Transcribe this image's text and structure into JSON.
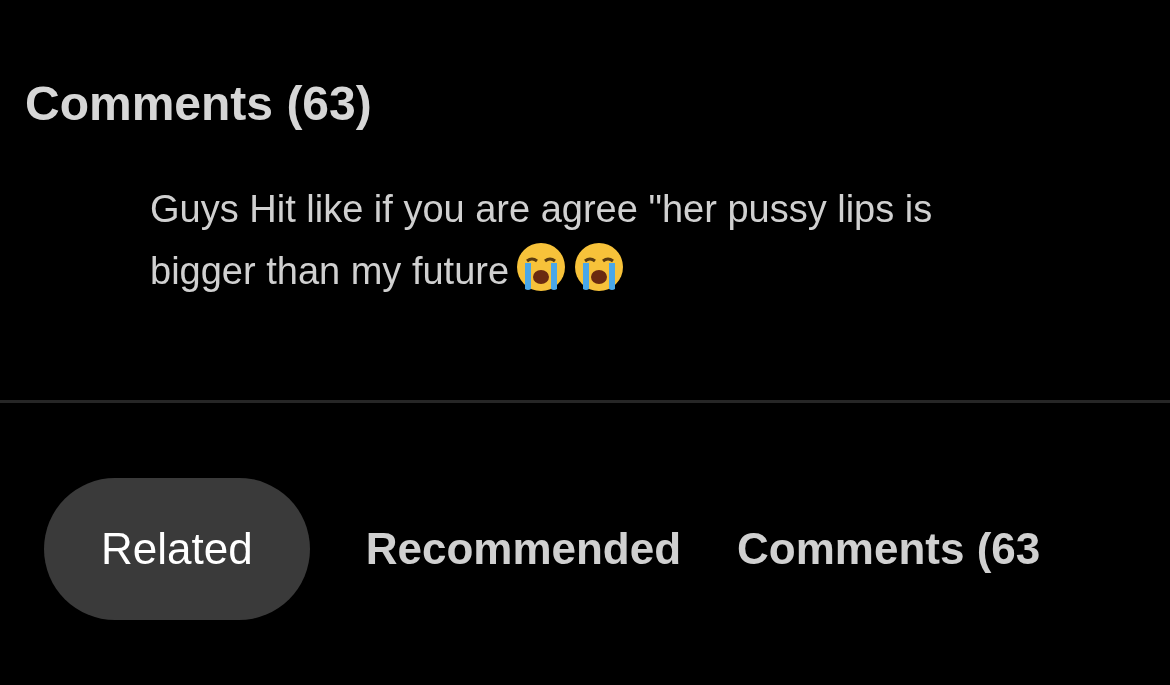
{
  "heading": "Comments (63)",
  "comments": [
    {
      "lines": [
        "Guys Hit like if you are agree \"her pussy lips is",
        "bigger than my future"
      ]
    }
  ],
  "tabs": [
    {
      "label": "Related",
      "selected": true
    },
    {
      "label": "Recommended",
      "selected": false
    },
    {
      "label": "Comments (63",
      "selected": false
    }
  ]
}
